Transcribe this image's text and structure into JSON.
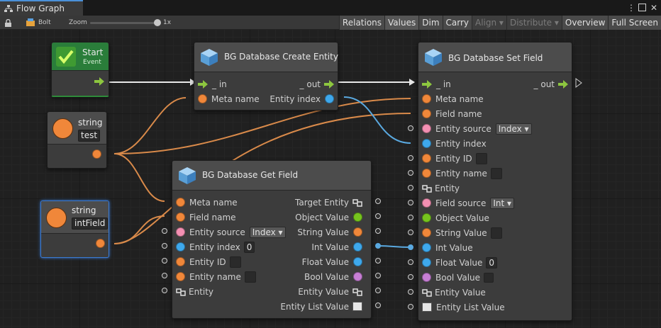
{
  "window": {
    "tab_title": "Flow Graph"
  },
  "toolbar": {
    "bolt_label": "Bolt",
    "zoom_label": "Zoom",
    "zoom_value": "1x",
    "zoom_level": 1.0,
    "buttons": [
      "Relations",
      "Values",
      "Dim",
      "Carry",
      "Align ▾",
      "Distribute ▾",
      "Overview",
      "Full Screen"
    ]
  },
  "start": {
    "title": "Start",
    "subtitle": "Event"
  },
  "string1": {
    "type": "string",
    "value": "test"
  },
  "string2": {
    "type": "string",
    "value": "intField"
  },
  "create": {
    "title": "BG Database Create Entity",
    "in": "_ in",
    "out": "_ out",
    "meta": "Meta  name",
    "entity_index": "Entity  index"
  },
  "get": {
    "title": "BG Database Get Field",
    "left": [
      "Meta  name",
      "Field  name",
      "Entity  source",
      "Entity  index",
      "Entity  ID",
      "Entity  name",
      "Entity"
    ],
    "source_value": "Index ▾",
    "index_value": "0",
    "right": [
      "Target Entity",
      "Object Value",
      "String Value",
      "Int Value",
      "Float Value",
      "Bool Value",
      "Entity Value",
      "Entity List Value"
    ]
  },
  "set": {
    "title": "BG Database Set Field",
    "in": "_ in",
    "out": "_ out",
    "rows": [
      "Meta  name",
      "Field  name",
      "Entity  source",
      "Entity  index",
      "Entity  ID",
      "Entity  name",
      "Entity",
      "Field  source",
      "Object Value",
      "String Value",
      "Int Value",
      "Float Value",
      "Bool Value",
      "Entity Value",
      "Entity List Value"
    ],
    "source_value": "Index ▾",
    "field_source_value": "Int ▾",
    "float_value": "0"
  },
  "colors": {
    "orange": "#f0873a",
    "blue": "#3ea8ec",
    "pink": "#f38fb2",
    "green": "#76c41e",
    "violet": "#c77ed4",
    "flow": "#8dc63f"
  }
}
